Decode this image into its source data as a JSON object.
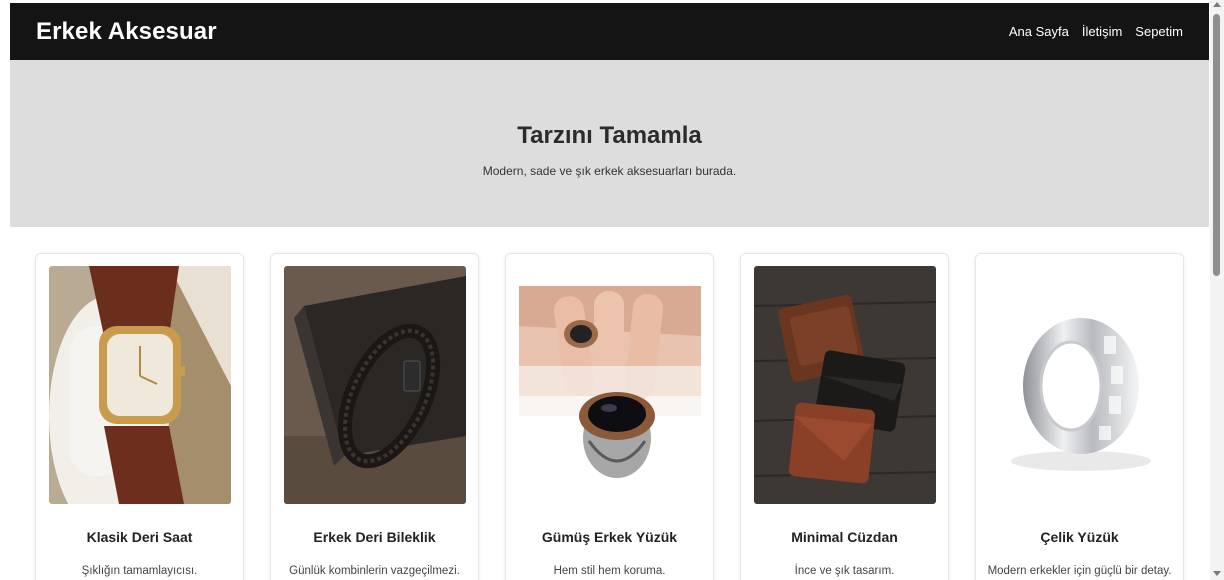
{
  "site": {
    "brand": "Erkek Aksesuar",
    "nav": [
      "Ana Sayfa",
      "İletişim",
      "Sepetim"
    ]
  },
  "hero": {
    "title": "Tarzını Tamamla",
    "subtitle": "Modern, sade ve şık erkek aksesuarları burada."
  },
  "products": [
    {
      "name": "Klasik Deri Saat",
      "desc": "Şıklığın tamamlayıcısı."
    },
    {
      "name": "Erkek Deri Bileklik",
      "desc": "Günlük kombinlerin vazgeçilmezi."
    },
    {
      "name": "Gümüş Erkek Yüzük",
      "desc": "Hem stil hem koruma."
    },
    {
      "name": "Minimal Cüzdan",
      "desc": "İnce ve şık tasarım."
    },
    {
      "name": "Çelik Yüzük",
      "desc": "Modern erkekler için güçlü bir detay."
    }
  ],
  "colors": {
    "navbar_bg": "#141414",
    "hero_bg": "#dddddd",
    "text_dark": "#222222"
  }
}
